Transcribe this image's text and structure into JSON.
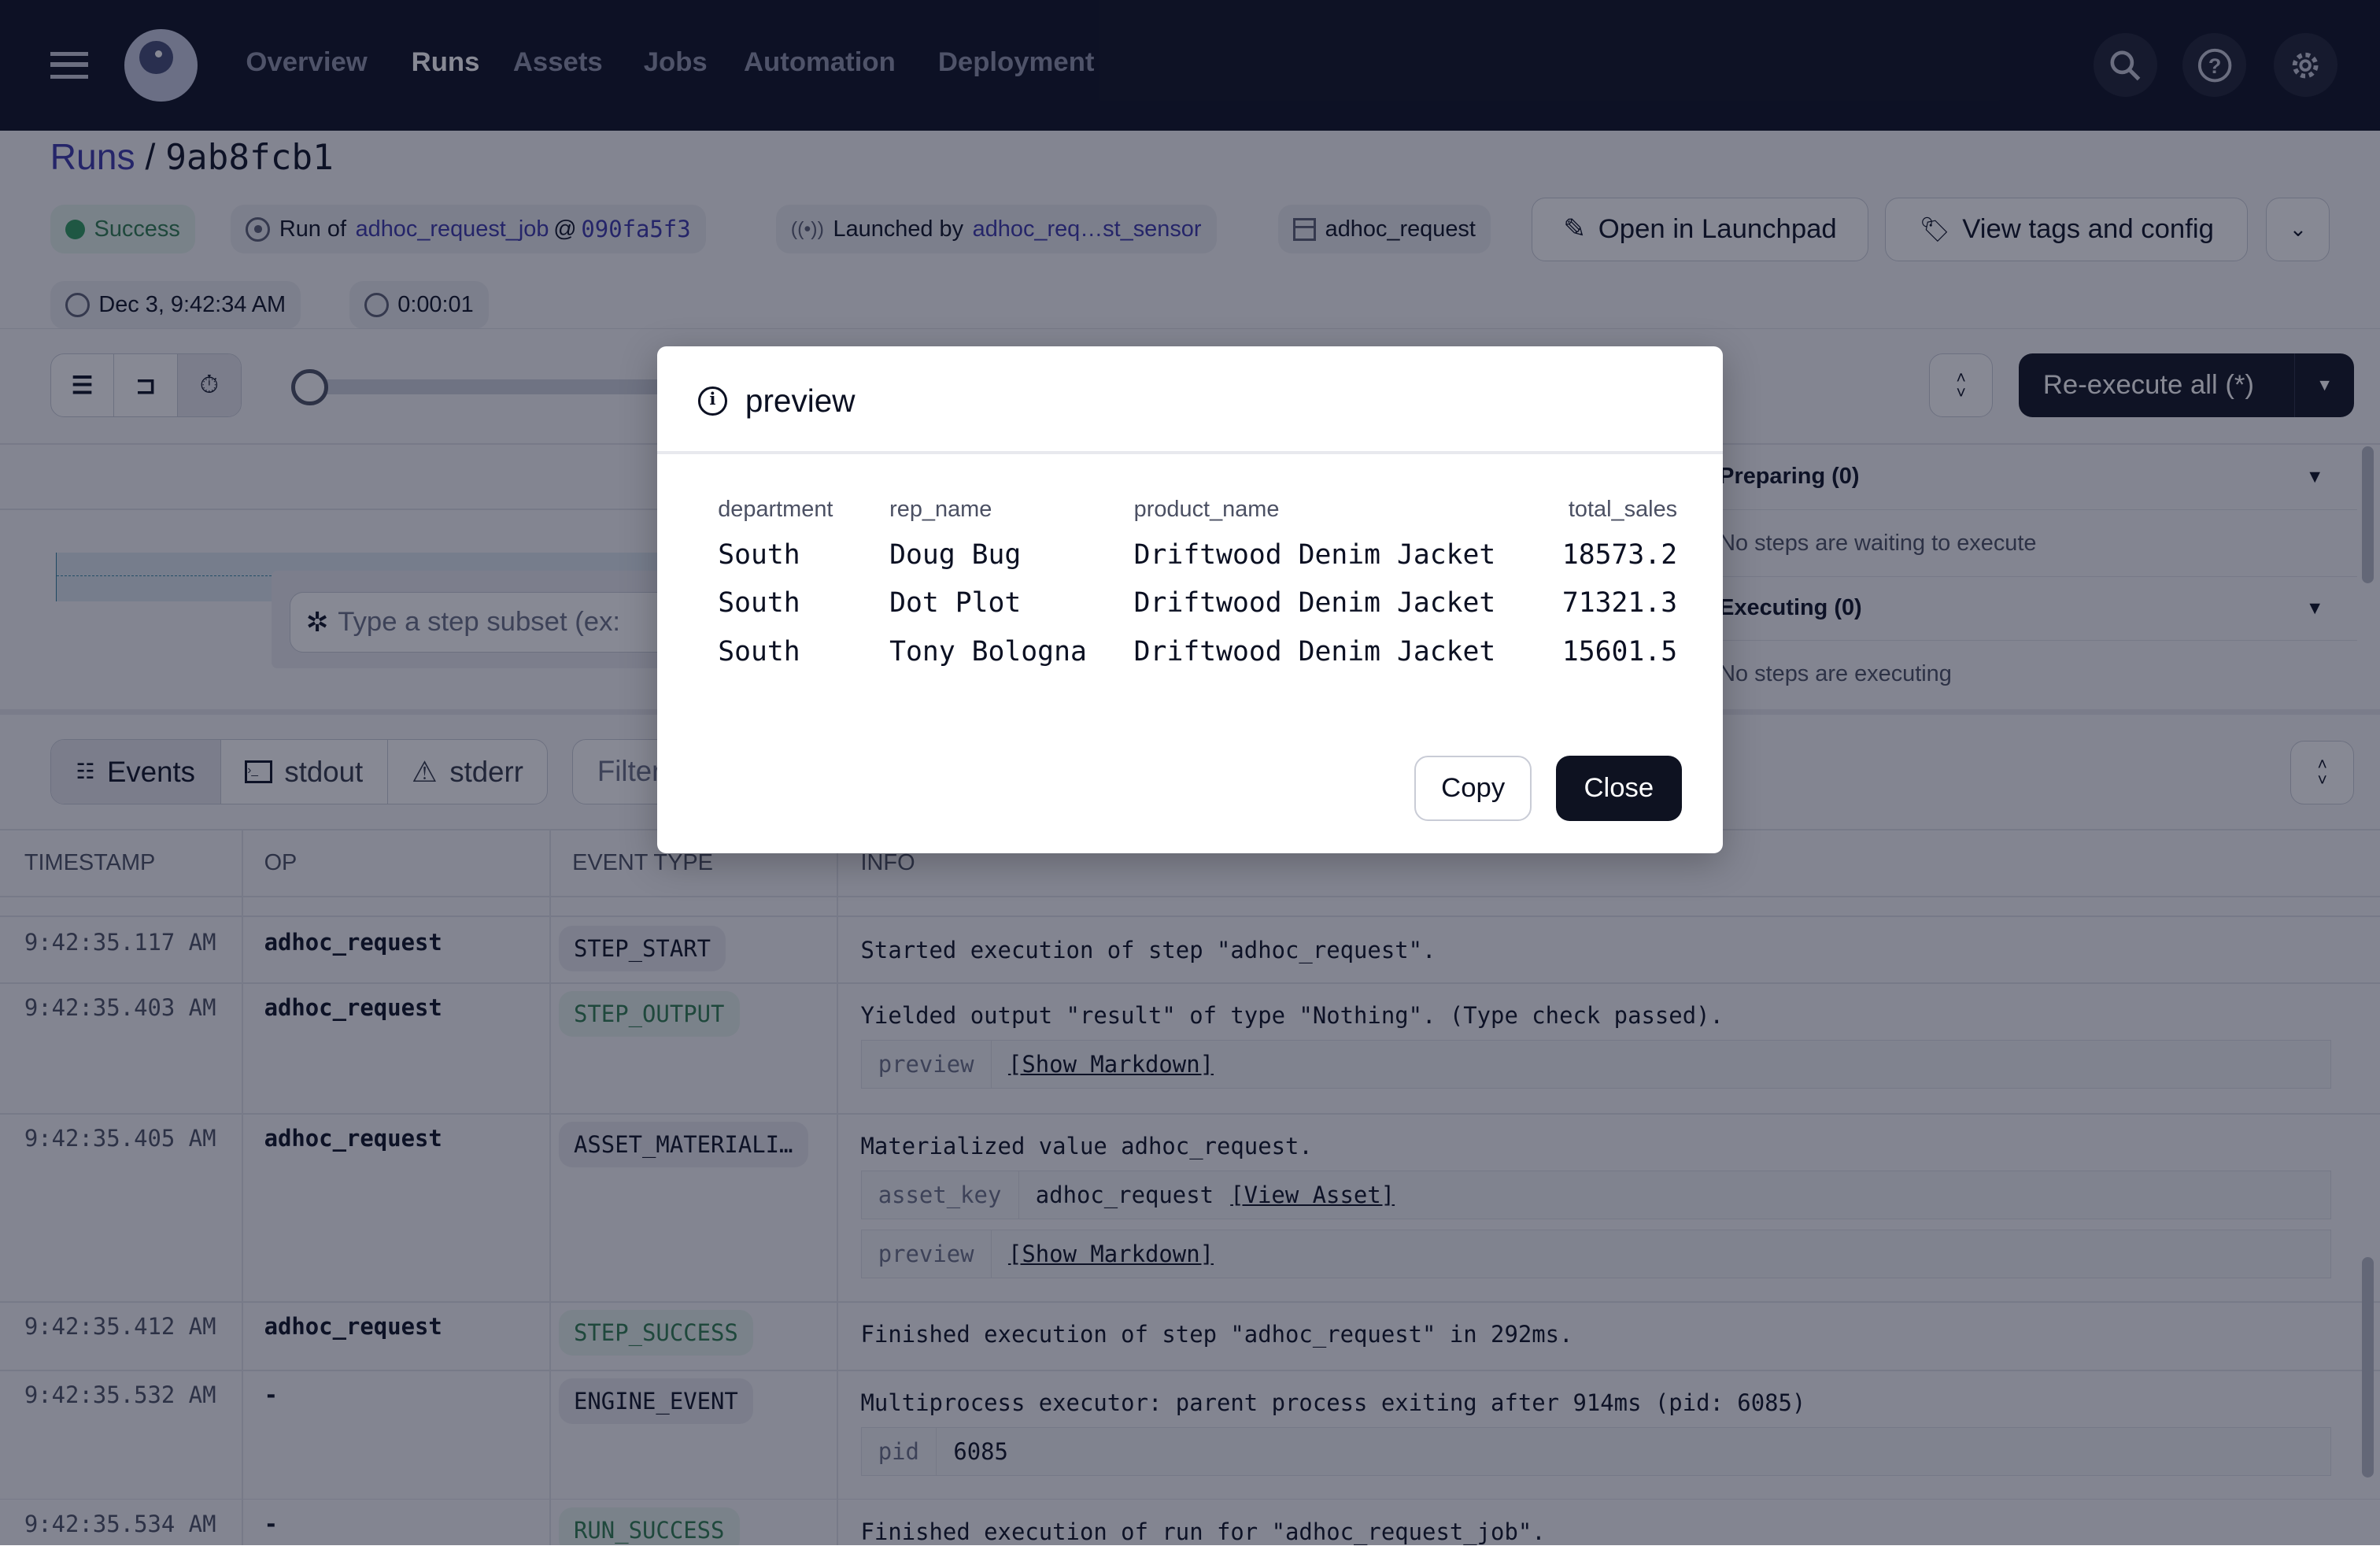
{
  "nav": {
    "items": [
      {
        "label": "Overview"
      },
      {
        "label": "Runs",
        "active": true
      },
      {
        "label": "Assets"
      },
      {
        "label": "Jobs"
      },
      {
        "label": "Automation"
      },
      {
        "label": "Deployment"
      }
    ]
  },
  "breadcrumb": {
    "parent": "Runs",
    "separator": "/",
    "current": "9ab8fcb1"
  },
  "run": {
    "status": "Success",
    "status_color": "#2e9a5c",
    "run_of_prefix": "Run of",
    "job": "adhoc_request_job",
    "at": "@",
    "snapshot": "090fa5f3",
    "launched_prefix": "Launched by",
    "sensor": "adhoc_req…st_sensor",
    "asset": "adhoc_request",
    "open_launchpad": "Open in Launchpad",
    "view_tags": "View tags and config",
    "date": "Dec 3, 9:42:34 AM",
    "duration": "0:00:01"
  },
  "toolbar": {
    "step_subset_placeholder": "Type a step subset (ex:",
    "reexecute": "Re-execute all (*)"
  },
  "steps_panel": {
    "preparing": "Preparing (0)",
    "preparing_empty": "No steps are waiting to execute",
    "executing": "Executing (0)",
    "executing_empty": "No steps are executing"
  },
  "logs": {
    "tabs": [
      {
        "label": "Events",
        "active": true
      },
      {
        "label": "stdout"
      },
      {
        "label": "stderr"
      }
    ],
    "filter_placeholder": "Filter",
    "columns": [
      "TIMESTAMP",
      "OP",
      "EVENT TYPE",
      "INFO"
    ],
    "rows": [
      {
        "time": "9:42:35.117 AM",
        "op": "adhoc_request",
        "type": "STEP_START",
        "info": "Started execution of step \"adhoc_request\"."
      },
      {
        "time": "9:42:35.403 AM",
        "op": "adhoc_request",
        "type": "STEP_OUTPUT",
        "info": "Yielded output \"result\" of type \"Nothing\". (Type check passed).",
        "meta": [
          {
            "key": "preview",
            "value": "[Show Markdown]",
            "link": true
          }
        ]
      },
      {
        "time": "9:42:35.405 AM",
        "op": "adhoc_request",
        "type": "ASSET_MATERIALI…",
        "info": "Materialized value adhoc_request.",
        "meta": [
          {
            "key": "asset_key",
            "value": "adhoc_request",
            "link_text": "[View Asset]"
          },
          {
            "key": "preview",
            "value": "[Show Markdown]",
            "link": true
          }
        ]
      },
      {
        "time": "9:42:35.412 AM",
        "op": "adhoc_request",
        "type": "STEP_SUCCESS",
        "info": "Finished execution of step \"adhoc_request\" in 292ms."
      },
      {
        "time": "9:42:35.532 AM",
        "op": "-",
        "type": "ENGINE_EVENT",
        "info": "Multiprocess executor: parent process exiting after 914ms (pid: 6085)",
        "meta": [
          {
            "key": "pid",
            "value": "6085"
          }
        ]
      },
      {
        "time": "9:42:35.534 AM",
        "op": "-",
        "type": "RUN_SUCCESS",
        "info": "Finished execution of run for \"adhoc_request_job\"."
      }
    ]
  },
  "modal": {
    "title": "preview",
    "columns": [
      "department",
      "rep_name",
      "product_name",
      "total_sales"
    ],
    "rows": [
      [
        "South",
        "Doug Bug",
        "Driftwood Denim Jacket",
        "18573.2"
      ],
      [
        "South",
        "Dot Plot",
        "Driftwood Denim Jacket",
        "71321.3"
      ],
      [
        "South",
        "Tony Bologna",
        "Driftwood Denim Jacket",
        "15601.5"
      ]
    ],
    "copy": "Copy",
    "close": "Close"
  }
}
